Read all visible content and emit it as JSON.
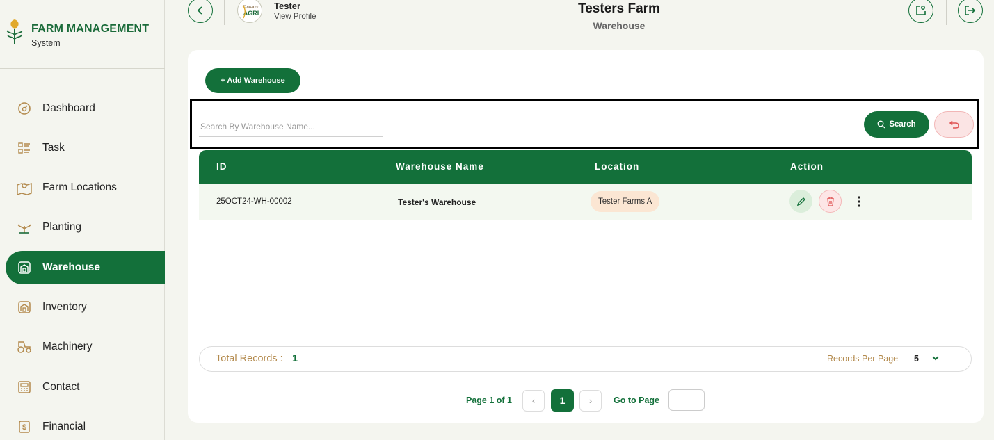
{
  "brand": {
    "title": "FARM MANAGEMENT",
    "subtitle": "System"
  },
  "sidebar": {
    "items": [
      {
        "label": "Dashboard",
        "icon": "dashboard-icon"
      },
      {
        "label": "Task",
        "icon": "task-icon"
      },
      {
        "label": "Farm Locations",
        "icon": "map-icon"
      },
      {
        "label": "Planting",
        "icon": "plant-icon"
      },
      {
        "label": "Warehouse",
        "icon": "warehouse-icon",
        "active": true
      },
      {
        "label": "Inventory",
        "icon": "inventory-icon"
      },
      {
        "label": "Machinery",
        "icon": "tractor-icon"
      },
      {
        "label": "Contact",
        "icon": "contact-icon"
      },
      {
        "label": "Financial",
        "icon": "dollar-icon"
      }
    ]
  },
  "header": {
    "user_name": "Tester",
    "view_profile": "View Profile",
    "avatar_text_top": "Concave",
    "avatar_text_bottom": "AGRI",
    "farm_title": "Testers Farm",
    "page_subtitle": "Warehouse"
  },
  "toolbar": {
    "add_label": "+ Add Warehouse"
  },
  "search": {
    "placeholder": "Search By Warehouse Name...",
    "value": "",
    "button_label": "Search"
  },
  "table": {
    "columns": [
      "ID",
      "Warehouse Name",
      "Location",
      "Action"
    ],
    "rows": [
      {
        "id": "25OCT24-WH-00002",
        "name": "Tester's Warehouse",
        "location": "Tester Farms A"
      }
    ]
  },
  "records": {
    "total_label": "Total Records :",
    "total_value": "1",
    "per_page_label": "Records Per Page",
    "per_page_value": "5"
  },
  "pagination": {
    "info": "Page 1 of 1",
    "current": "1",
    "prev": "‹",
    "next": "›",
    "goto_label": "Go to Page",
    "goto_value": ""
  },
  "colors": {
    "primary": "#13703a",
    "accent_brown": "#b38a4d",
    "danger": "#e05555",
    "location_badge": "#fbe6d3"
  }
}
